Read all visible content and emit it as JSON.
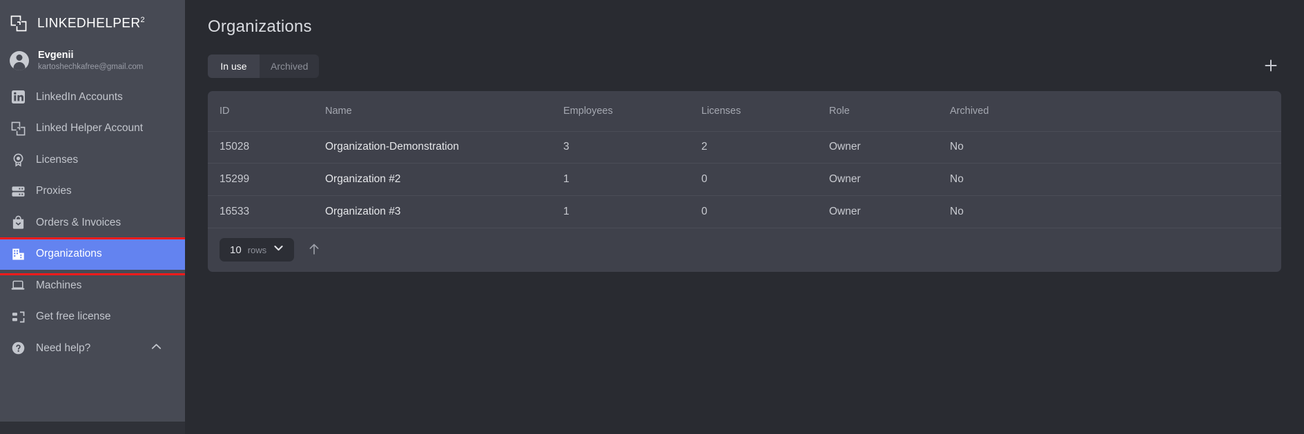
{
  "sidebar": {
    "brand": {
      "name": "LINKEDHELPER",
      "sup": "2",
      "icon": "linkedhelper-logo-icon"
    },
    "account": {
      "name": "Evgenii",
      "email": "kartoshechkafree@gmail.com"
    },
    "items": [
      {
        "label": "LinkedIn Accounts",
        "icon": "linkedin-icon",
        "active": false
      },
      {
        "label": "Linked Helper Account",
        "icon": "linkedhelper-icon",
        "active": false
      },
      {
        "label": "Licenses",
        "icon": "license-badge-icon",
        "active": false
      },
      {
        "label": "Proxies",
        "icon": "server-icon",
        "active": false
      },
      {
        "label": "Orders & Invoices",
        "icon": "bag-icon",
        "active": false
      },
      {
        "label": "Organizations",
        "icon": "building-icon",
        "active": true
      },
      {
        "label": "Machines",
        "icon": "laptop-icon",
        "active": false
      },
      {
        "label": "Get free license",
        "icon": "gift-share-icon",
        "active": false
      },
      {
        "label": "Need help?",
        "icon": "question-circle-icon",
        "active": false,
        "trailing_icon": "chevron-up-icon"
      }
    ]
  },
  "main": {
    "title": "Organizations",
    "tabs": [
      {
        "label": "In use",
        "active": true
      },
      {
        "label": "Archived",
        "active": false
      }
    ],
    "add_button": {
      "icon": "plus-icon",
      "label": "+"
    },
    "table": {
      "columns": [
        "ID",
        "Name",
        "Employees",
        "Licenses",
        "Role",
        "Archived"
      ],
      "rows": [
        {
          "id": "15028",
          "name": "Organization-Demonstration",
          "employees": "3",
          "licenses": "2",
          "role": "Owner",
          "archived": "No"
        },
        {
          "id": "15299",
          "name": "Organization #2",
          "employees": "1",
          "licenses": "0",
          "role": "Owner",
          "archived": "No"
        },
        {
          "id": "16533",
          "name": "Organization #3",
          "employees": "1",
          "licenses": "0",
          "role": "Owner",
          "archived": "No"
        }
      ]
    },
    "footer": {
      "rows_value": "10",
      "rows_label": "rows",
      "rows_chevron": "chevron-down-icon",
      "scroll_top_icon": "arrow-up-icon"
    }
  },
  "colors": {
    "sidebar_bg": "#474a54",
    "main_bg": "#292b31",
    "card_bg": "#3f414b",
    "accent_blue": "#6383f0",
    "annotation_red": "#f81b1b",
    "tab_inactive_bg": "#33353d"
  }
}
